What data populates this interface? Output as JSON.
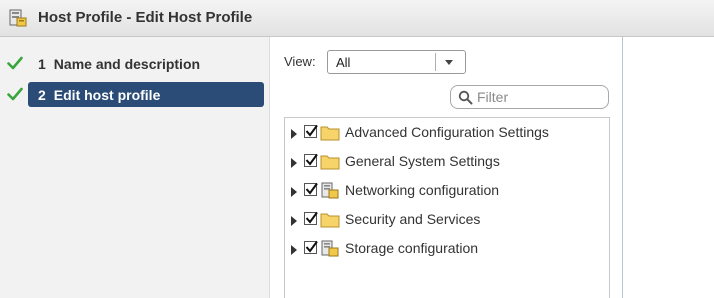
{
  "window": {
    "title": "Host Profile - Edit Host Profile",
    "icon": "host-profile-icon"
  },
  "wizard": {
    "steps": [
      {
        "number": "1",
        "label": "Name and description",
        "completed": true,
        "active": false
      },
      {
        "number": "2",
        "label": "Edit host profile",
        "completed": true,
        "active": true
      }
    ],
    "active_color": "#2a4c77",
    "check_color": "#3aa53a"
  },
  "main": {
    "view": {
      "label": "View:",
      "selected": "All"
    },
    "filter": {
      "placeholder": "Filter"
    },
    "tree": {
      "items": [
        {
          "label": "Advanced Configuration Settings",
          "icon": "folder-icon",
          "checked": true
        },
        {
          "label": "General System Settings",
          "icon": "folder-icon",
          "checked": true
        },
        {
          "label": "Networking configuration",
          "icon": "profile-component-icon",
          "checked": true
        },
        {
          "label": "Security and Services",
          "icon": "folder-icon",
          "checked": true
        },
        {
          "label": "Storage configuration",
          "icon": "profile-component-icon",
          "checked": true
        }
      ]
    }
  }
}
